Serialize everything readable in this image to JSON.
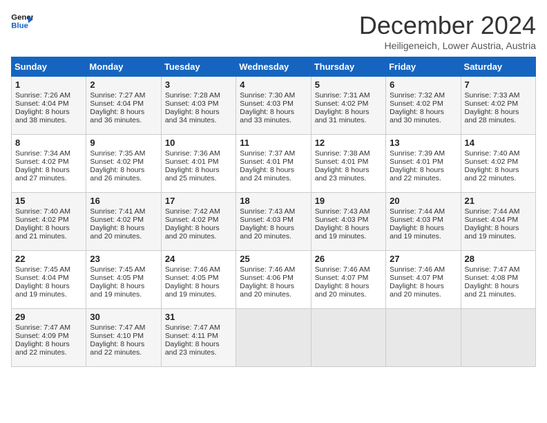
{
  "header": {
    "logo_line1": "General",
    "logo_line2": "Blue",
    "month": "December 2024",
    "location": "Heiligeneich, Lower Austria, Austria"
  },
  "days_of_week": [
    "Sunday",
    "Monday",
    "Tuesday",
    "Wednesday",
    "Thursday",
    "Friday",
    "Saturday"
  ],
  "weeks": [
    [
      {
        "day": "1",
        "lines": [
          "Sunrise: 7:26 AM",
          "Sunset: 4:04 PM",
          "Daylight: 8 hours",
          "and 38 minutes."
        ]
      },
      {
        "day": "2",
        "lines": [
          "Sunrise: 7:27 AM",
          "Sunset: 4:04 PM",
          "Daylight: 8 hours",
          "and 36 minutes."
        ]
      },
      {
        "day": "3",
        "lines": [
          "Sunrise: 7:28 AM",
          "Sunset: 4:03 PM",
          "Daylight: 8 hours",
          "and 34 minutes."
        ]
      },
      {
        "day": "4",
        "lines": [
          "Sunrise: 7:30 AM",
          "Sunset: 4:03 PM",
          "Daylight: 8 hours",
          "and 33 minutes."
        ]
      },
      {
        "day": "5",
        "lines": [
          "Sunrise: 7:31 AM",
          "Sunset: 4:02 PM",
          "Daylight: 8 hours",
          "and 31 minutes."
        ]
      },
      {
        "day": "6",
        "lines": [
          "Sunrise: 7:32 AM",
          "Sunset: 4:02 PM",
          "Daylight: 8 hours",
          "and 30 minutes."
        ]
      },
      {
        "day": "7",
        "lines": [
          "Sunrise: 7:33 AM",
          "Sunset: 4:02 PM",
          "Daylight: 8 hours",
          "and 28 minutes."
        ]
      }
    ],
    [
      {
        "day": "8",
        "lines": [
          "Sunrise: 7:34 AM",
          "Sunset: 4:02 PM",
          "Daylight: 8 hours",
          "and 27 minutes."
        ]
      },
      {
        "day": "9",
        "lines": [
          "Sunrise: 7:35 AM",
          "Sunset: 4:02 PM",
          "Daylight: 8 hours",
          "and 26 minutes."
        ]
      },
      {
        "day": "10",
        "lines": [
          "Sunrise: 7:36 AM",
          "Sunset: 4:01 PM",
          "Daylight: 8 hours",
          "and 25 minutes."
        ]
      },
      {
        "day": "11",
        "lines": [
          "Sunrise: 7:37 AM",
          "Sunset: 4:01 PM",
          "Daylight: 8 hours",
          "and 24 minutes."
        ]
      },
      {
        "day": "12",
        "lines": [
          "Sunrise: 7:38 AM",
          "Sunset: 4:01 PM",
          "Daylight: 8 hours",
          "and 23 minutes."
        ]
      },
      {
        "day": "13",
        "lines": [
          "Sunrise: 7:39 AM",
          "Sunset: 4:01 PM",
          "Daylight: 8 hours",
          "and 22 minutes."
        ]
      },
      {
        "day": "14",
        "lines": [
          "Sunrise: 7:40 AM",
          "Sunset: 4:02 PM",
          "Daylight: 8 hours",
          "and 22 minutes."
        ]
      }
    ],
    [
      {
        "day": "15",
        "lines": [
          "Sunrise: 7:40 AM",
          "Sunset: 4:02 PM",
          "Daylight: 8 hours",
          "and 21 minutes."
        ]
      },
      {
        "day": "16",
        "lines": [
          "Sunrise: 7:41 AM",
          "Sunset: 4:02 PM",
          "Daylight: 8 hours",
          "and 20 minutes."
        ]
      },
      {
        "day": "17",
        "lines": [
          "Sunrise: 7:42 AM",
          "Sunset: 4:02 PM",
          "Daylight: 8 hours",
          "and 20 minutes."
        ]
      },
      {
        "day": "18",
        "lines": [
          "Sunrise: 7:43 AM",
          "Sunset: 4:03 PM",
          "Daylight: 8 hours",
          "and 20 minutes."
        ]
      },
      {
        "day": "19",
        "lines": [
          "Sunrise: 7:43 AM",
          "Sunset: 4:03 PM",
          "Daylight: 8 hours",
          "and 19 minutes."
        ]
      },
      {
        "day": "20",
        "lines": [
          "Sunrise: 7:44 AM",
          "Sunset: 4:03 PM",
          "Daylight: 8 hours",
          "and 19 minutes."
        ]
      },
      {
        "day": "21",
        "lines": [
          "Sunrise: 7:44 AM",
          "Sunset: 4:04 PM",
          "Daylight: 8 hours",
          "and 19 minutes."
        ]
      }
    ],
    [
      {
        "day": "22",
        "lines": [
          "Sunrise: 7:45 AM",
          "Sunset: 4:04 PM",
          "Daylight: 8 hours",
          "and 19 minutes."
        ]
      },
      {
        "day": "23",
        "lines": [
          "Sunrise: 7:45 AM",
          "Sunset: 4:05 PM",
          "Daylight: 8 hours",
          "and 19 minutes."
        ]
      },
      {
        "day": "24",
        "lines": [
          "Sunrise: 7:46 AM",
          "Sunset: 4:05 PM",
          "Daylight: 8 hours",
          "and 19 minutes."
        ]
      },
      {
        "day": "25",
        "lines": [
          "Sunrise: 7:46 AM",
          "Sunset: 4:06 PM",
          "Daylight: 8 hours",
          "and 20 minutes."
        ]
      },
      {
        "day": "26",
        "lines": [
          "Sunrise: 7:46 AM",
          "Sunset: 4:07 PM",
          "Daylight: 8 hours",
          "and 20 minutes."
        ]
      },
      {
        "day": "27",
        "lines": [
          "Sunrise: 7:46 AM",
          "Sunset: 4:07 PM",
          "Daylight: 8 hours",
          "and 20 minutes."
        ]
      },
      {
        "day": "28",
        "lines": [
          "Sunrise: 7:47 AM",
          "Sunset: 4:08 PM",
          "Daylight: 8 hours",
          "and 21 minutes."
        ]
      }
    ],
    [
      {
        "day": "29",
        "lines": [
          "Sunrise: 7:47 AM",
          "Sunset: 4:09 PM",
          "Daylight: 8 hours",
          "and 22 minutes."
        ]
      },
      {
        "day": "30",
        "lines": [
          "Sunrise: 7:47 AM",
          "Sunset: 4:10 PM",
          "Daylight: 8 hours",
          "and 22 minutes."
        ]
      },
      {
        "day": "31",
        "lines": [
          "Sunrise: 7:47 AM",
          "Sunset: 4:11 PM",
          "Daylight: 8 hours",
          "and 23 minutes."
        ]
      },
      null,
      null,
      null,
      null
    ]
  ]
}
